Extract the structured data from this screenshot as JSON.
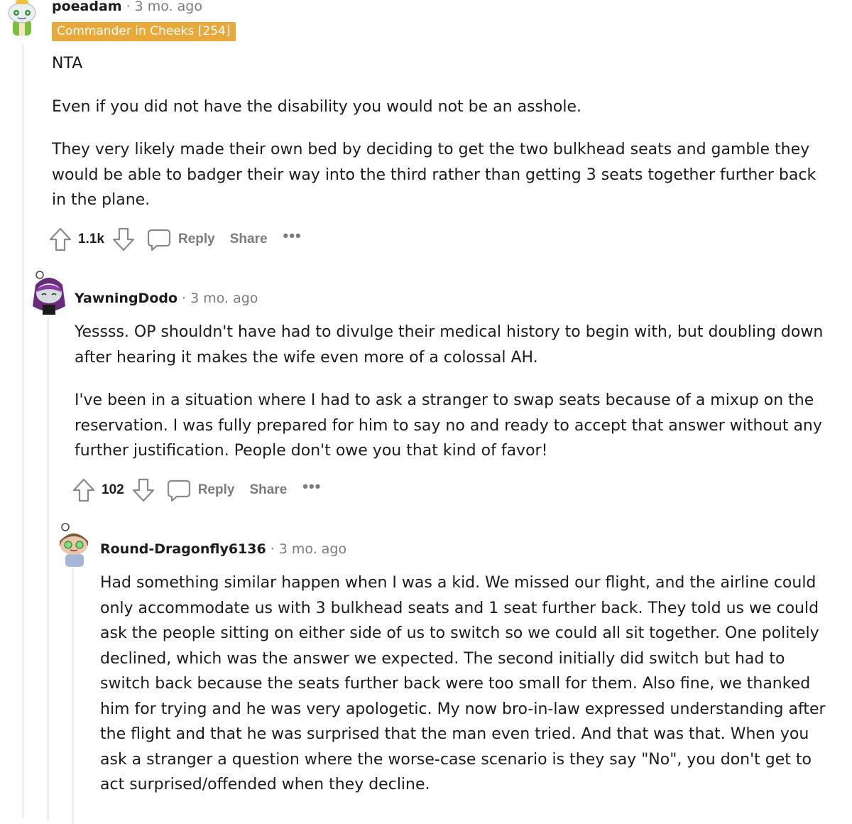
{
  "comments": [
    {
      "author": "poeadam",
      "time": "3 mo. ago",
      "flair": "Commander in Cheeks [254]",
      "paragraphs": [
        "NTA",
        "Even if you did not have the disability you would not be an asshole.",
        "They very likely made their own bed by deciding to get the two bulkhead seats and gamble they would be able to badger their way into the third rather than getting 3 seats together further back in the plane."
      ],
      "score": "1.1k",
      "reply_label": "Reply",
      "share_label": "Share",
      "more_label": "•••"
    },
    {
      "author": "YawningDodo",
      "time": "3 mo. ago",
      "paragraphs": [
        "Yessss. OP shouldn't have had to divulge their medical history to begin with, but doubling down after hearing it makes the wife even more of a colossal AH.",
        "I've been in a situation where I had to ask a stranger to swap seats because of a mixup on the reservation. I was fully prepared for him to say no and ready to accept that answer without any further justification. People don't owe you that kind of favor!"
      ],
      "score": "102",
      "reply_label": "Reply",
      "share_label": "Share",
      "more_label": "•••"
    },
    {
      "author": "Round-Dragonfly6136",
      "time": "3 mo. ago",
      "paragraphs": [
        "Had something similar happen when I was a kid. We missed our flight, and the airline could only accommodate us with 3 bulkhead seats and 1 seat further back. They told us we could ask the people sitting on either side of us to switch so we could all sit together. One politely declined, which was the answer we expected. The second initially did switch but had to switch back because the seats further back were too small for them. Also fine, we thanked him for trying and he was very apologetic. My now bro-in-law expressed understanding after the flight and that he was surprised that the man even tried. And that was that. When you ask a stranger a question where the worse-case scenario is they say \"No\", you don't get to act surprised/offended when they decline."
      ]
    }
  ],
  "separator": "·",
  "colors": {
    "flair_bg": "#e8a83a",
    "thread_line": "#edeff1",
    "meta_gray": "#7c7c7c"
  }
}
